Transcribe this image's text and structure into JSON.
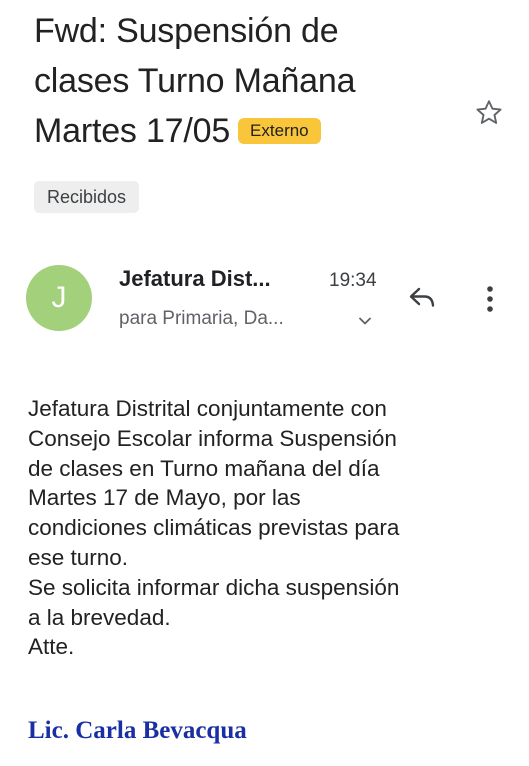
{
  "email": {
    "subject_lines": [
      "Fwd: Suspensión de",
      "clases Turno Mañana",
      "Martes 17/05"
    ],
    "badge_label": "Externo",
    "star_icon": "star-outline-icon",
    "label_chip": "Recibidos",
    "sender": {
      "avatar_letter": "J",
      "avatar_color": "#a3d07a",
      "name": "Jefatura Dist...",
      "time": "19:34",
      "recipients": "para Primaria, Da...",
      "expand_icon": "chevron-down-icon"
    },
    "actions": {
      "reply_icon": "reply-icon",
      "more_icon": "more-vert-icon"
    },
    "body_lines": [
      "Jefatura Distrital conjuntamente con",
      "Consejo Escolar informa Suspensión",
      "de clases en Turno mañana del día",
      "Martes 17 de Mayo, por las",
      "condiciones climáticas previstas para",
      "ese turno.",
      "Se solicita informar dicha suspensión",
      "a la brevedad.",
      "Atte."
    ],
    "signature": "Lic. Carla Bevacqua",
    "colors": {
      "badge": "#f9c53a",
      "signature": "#1a2fa3",
      "chip_bg": "#eeeeee"
    }
  }
}
